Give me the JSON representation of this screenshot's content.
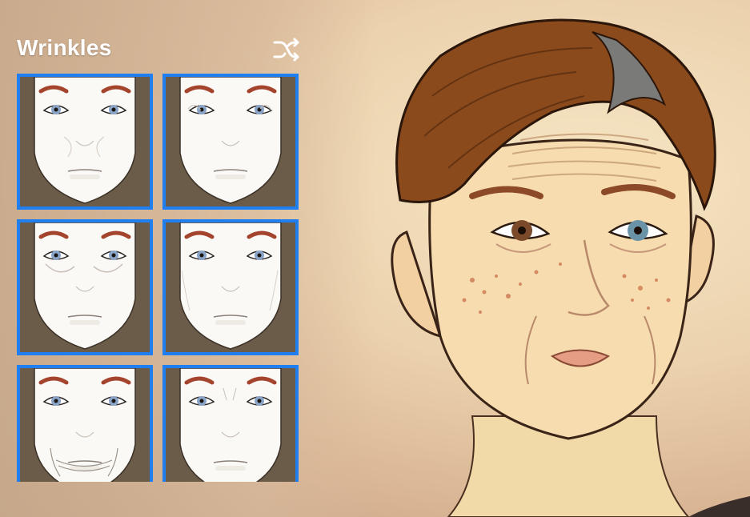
{
  "panel": {
    "title": "Wrinkles",
    "shuffle_icon": "shuffle-icon"
  },
  "options": [
    {
      "name": "wrinkle-option-1"
    },
    {
      "name": "wrinkle-option-2"
    },
    {
      "name": "wrinkle-option-3"
    },
    {
      "name": "wrinkle-option-4"
    },
    {
      "name": "wrinkle-option-5"
    },
    {
      "name": "wrinkle-option-6"
    }
  ],
  "colors": {
    "tile_border": "#1f7ff0",
    "title_text": "#ffffff",
    "hair": "#8a4a1c",
    "brow_swatch": "#a4442c"
  }
}
